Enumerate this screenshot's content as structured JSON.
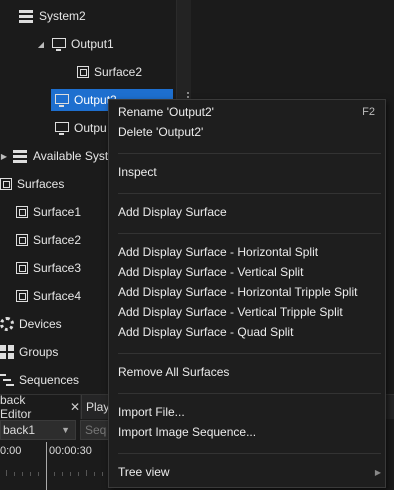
{
  "tree": {
    "system2": "System2",
    "output1": "Output1",
    "surface2_top": "Surface2",
    "output2": "Output2",
    "output_partial": "Outpu",
    "available_systems": "Available Syst",
    "surfaces": "Surfaces",
    "surface_items": [
      "Surface1",
      "Surface2",
      "Surface3",
      "Surface4"
    ],
    "devices": "Devices",
    "groups": "Groups",
    "sequences": "Sequences"
  },
  "bottom_panel": {
    "tab1_label": "back Editor",
    "tab2_label": "Play",
    "combo_value": "back1",
    "seq_placeholder": "Seq",
    "time_marks": [
      "0:00",
      "00:00:30"
    ]
  },
  "context_menu": {
    "items": [
      {
        "label": "Rename 'Output2'",
        "shortcut": "F2"
      },
      {
        "label": "Delete 'Output2'"
      },
      {
        "label": "Inspect"
      },
      {
        "label": "Add Display Surface"
      },
      {
        "label": "Add Display Surface - Horizontal Split"
      },
      {
        "label": "Add Display Surface - Vertical Split"
      },
      {
        "label": "Add Display Surface - Horizontal Tripple Split"
      },
      {
        "label": "Add Display Surface - Vertical Tripple Split"
      },
      {
        "label": "Add Display Surface - Quad Split"
      },
      {
        "label": "Remove All Surfaces"
      },
      {
        "label": "Import File..."
      },
      {
        "label": "Import Image Sequence..."
      },
      {
        "label": "Tree view"
      }
    ]
  },
  "colors": {
    "selection": "#1e6fcf",
    "background": "#1b1b1b",
    "menu_bg": "#1e1e1e"
  }
}
